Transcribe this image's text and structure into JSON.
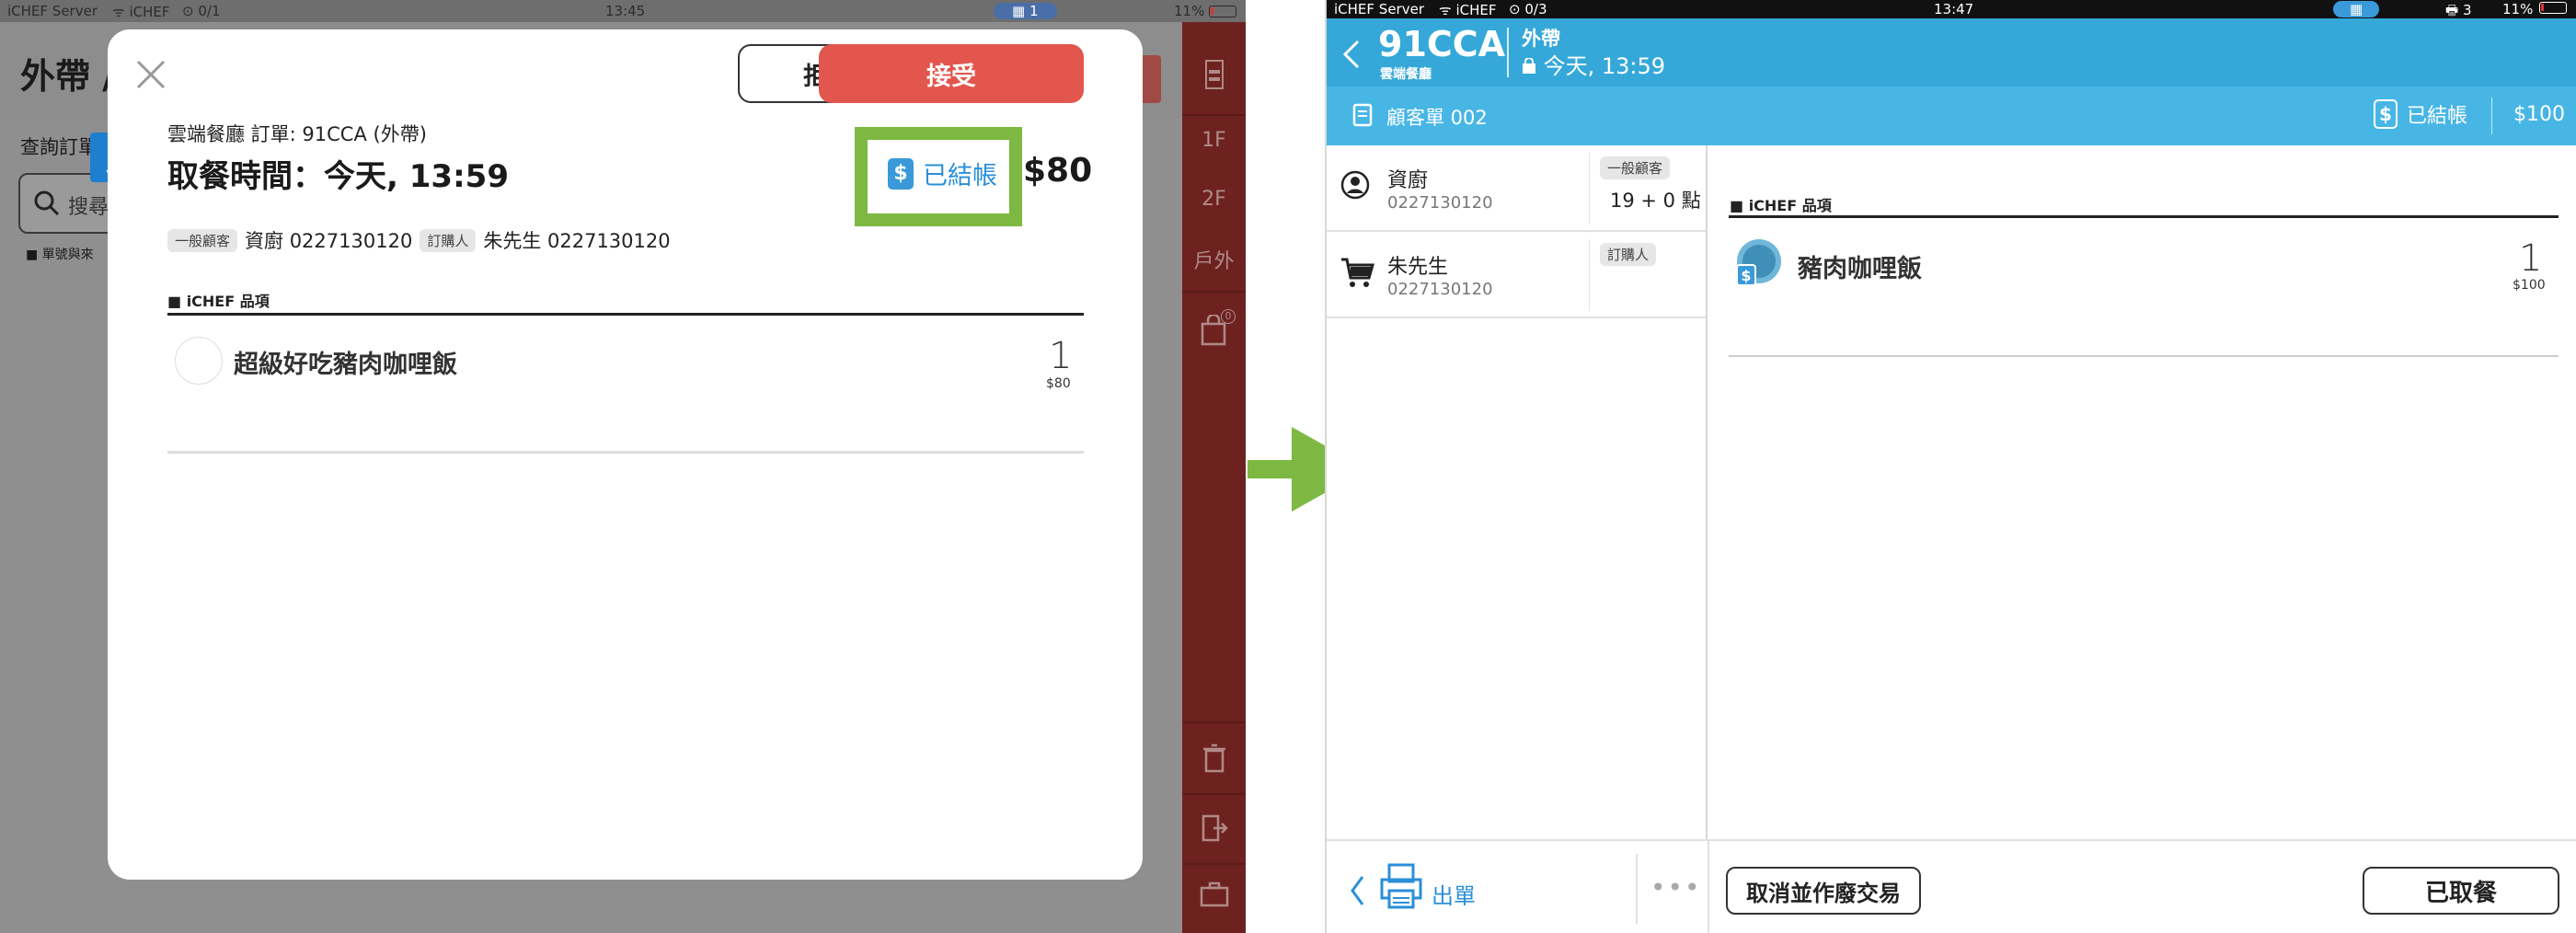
{
  "left": {
    "status_bar": {
      "carrier": "iCHEF Server",
      "wifi": "iCHEF",
      "sync": "0/1",
      "time": "13:45",
      "printer": "1",
      "battery": "11%"
    },
    "background": {
      "title": "外帶 /",
      "query_label": "查詢訂單",
      "search_placeholder": "搜尋",
      "small_label": "■ 單號與來",
      "floors": [
        "1F",
        "2F",
        "戶外"
      ],
      "cart_badge": "0"
    },
    "modal": {
      "reject_label": "拒絕",
      "accept_label": "接受",
      "restaurant_line": "雲端餐廳 訂單: 91CCA (外帶)",
      "pickup_time": "取餐時間：今天, 13:59",
      "paid_label": "已結帳",
      "amount": "$80",
      "customer_tag": "一般顧客",
      "customer_text": "資廚 0227130120",
      "orderer_tag": "訂購人",
      "orderer_text": "朱先生 0227130120",
      "section_title": "■ iCHEF 品項",
      "item_name": "超級好吃豬肉咖哩飯",
      "item_qty": "1",
      "item_price": "$80"
    }
  },
  "right": {
    "status_bar": {
      "carrier": "iCHEF Server",
      "wifi": "iCHEF",
      "sync": "0/3",
      "time": "13:47",
      "printer": "3",
      "battery": "11%"
    },
    "header": {
      "order_code": "91CCA",
      "restaurant": "雲端餐廳",
      "order_type": "外帶",
      "time": "今天, 13:59"
    },
    "subheader": {
      "title": "顧客單 002",
      "paid_label": "已結帳",
      "amount": "$100"
    },
    "customers": [
      {
        "name": "資廚",
        "phone": "0227130120",
        "tag": "一般顧客",
        "points": "19 + 0 點"
      },
      {
        "name": "朱先生",
        "phone": "0227130120",
        "tag": "訂購人"
      }
    ],
    "section_title": "■ iCHEF 品項",
    "item": {
      "name": "豬肉咖哩飯",
      "qty": "1",
      "price": "$100"
    },
    "footer": {
      "print_label": "出單",
      "more": "•••",
      "cancel_label": "取消並作廢交易",
      "picked_label": "已取餐"
    }
  },
  "colors": {
    "accent_blue": "#35a8d9",
    "accept_red": "#e2564e",
    "highlight_green": "#7cb842",
    "arrow_green": "#7cb842"
  },
  "icons": [
    "close-icon",
    "walking-icon",
    "dollar-icon",
    "search-icon",
    "back-icon",
    "bag-icon",
    "receipt-icon",
    "user-icon",
    "cart-icon",
    "printer-icon",
    "trash-icon",
    "exit-icon"
  ]
}
